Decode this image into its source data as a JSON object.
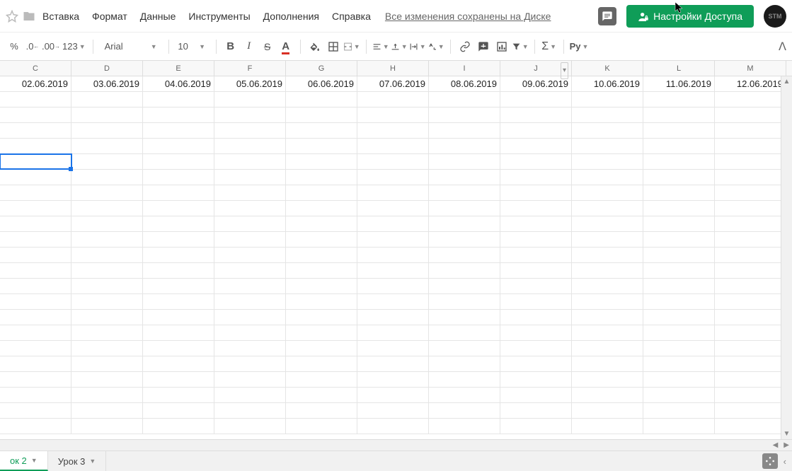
{
  "menu": {
    "items": [
      "Вставка",
      "Формат",
      "Данные",
      "Инструменты",
      "Дополнения",
      "Справка"
    ],
    "save_status": "Все изменения сохранены на Диске"
  },
  "share": {
    "label": "Настройки Доступа"
  },
  "avatar": {
    "text": "STM"
  },
  "toolbar": {
    "percent": "%",
    "dec_dec": ".0",
    "inc_dec": ".00",
    "more_formats": "123",
    "font": "Arial",
    "font_size": "10",
    "text_color_letter": "A",
    "script_label": "Рy"
  },
  "columns": [
    {
      "letter": "C",
      "filter": false
    },
    {
      "letter": "D",
      "filter": false
    },
    {
      "letter": "E",
      "filter": false
    },
    {
      "letter": "F",
      "filter": false
    },
    {
      "letter": "G",
      "filter": false
    },
    {
      "letter": "H",
      "filter": false
    },
    {
      "letter": "I",
      "filter": false
    },
    {
      "letter": "J",
      "filter": true
    },
    {
      "letter": "K",
      "filter": false
    },
    {
      "letter": "L",
      "filter": false
    },
    {
      "letter": "M",
      "filter": false
    }
  ],
  "data_row": [
    "02.06.2019",
    "03.06.2019",
    "04.06.2019",
    "05.06.2019",
    "06.06.2019",
    "07.06.2019",
    "08.06.2019",
    "09.06.2019",
    "10.06.2019",
    "11.06.2019",
    "12.06.2019"
  ],
  "selected": {
    "row": 5,
    "col": 0
  },
  "sheets": [
    {
      "name": "ок 2",
      "active": true
    },
    {
      "name": "Урок 3",
      "active": false
    }
  ]
}
